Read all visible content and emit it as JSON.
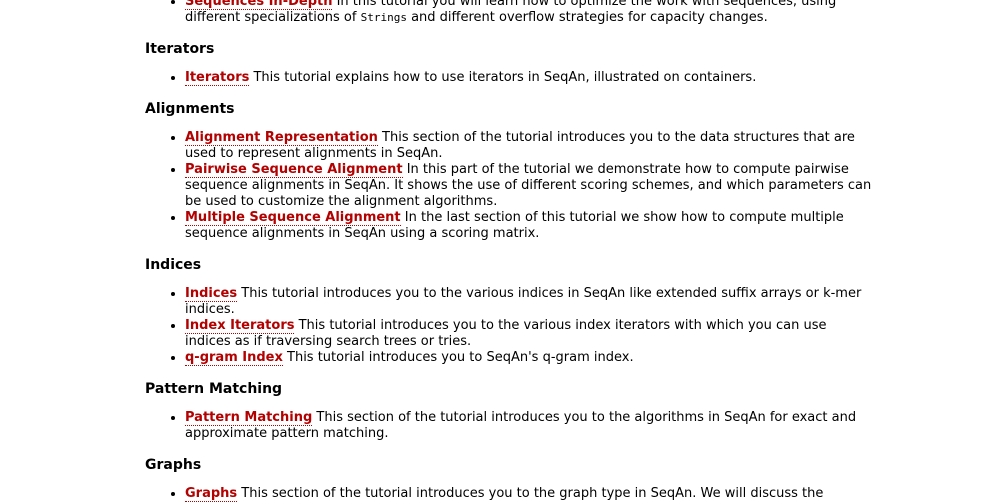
{
  "sections": [
    {
      "heading": "",
      "items": [
        {
          "link": "Sequences In-Depth",
          "text_before_code": " In this tutorial you will learn how to optimize the work with sequences, using different specializations of ",
          "code": "Strings",
          "text_after_code": " and different overflow strategies for capacity changes."
        }
      ]
    },
    {
      "heading": "Iterators",
      "items": [
        {
          "link": "Iterators",
          "text": " This tutorial explains how to use iterators in SeqAn, illustrated on containers."
        }
      ]
    },
    {
      "heading": "Alignments",
      "items": [
        {
          "link": "Alignment Representation",
          "text": " This section of the tutorial introduces you to the data structures that are used to represent alignments in SeqAn."
        },
        {
          "link": "Pairwise Sequence Alignment",
          "text": " In this part of the tutorial we demonstrate how to compute pairwise sequence alignments in SeqAn. It shows the use of different scoring schemes, and which parameters can be used to customize the alignment algorithms."
        },
        {
          "link": "Multiple Sequence Alignment",
          "text": " In the last section of this tutorial we show how to compute multiple sequence alignments in SeqAn using a scoring matrix."
        }
      ]
    },
    {
      "heading": "Indices",
      "items": [
        {
          "link": "Indices",
          "text": " This tutorial introduces you to the various indices in SeqAn like extended suffix arrays or k-mer indices."
        },
        {
          "link": "Index Iterators",
          "text": " This tutorial introduces you to the various index iterators with which you can use indices as if traversing search trees or tries."
        },
        {
          "link": "q-gram Index",
          "text": " This tutorial introduces you to SeqAn's q-gram index."
        }
      ]
    },
    {
      "heading": "Pattern Matching",
      "items": [
        {
          "link": "Pattern Matching",
          "text": " This section of the tutorial introduces you to the algorithms in SeqAn for exact and approximate pattern matching."
        }
      ]
    },
    {
      "heading": "Graphs",
      "items": [
        {
          "link": "Graphs",
          "text": " This section of the tutorial introduces you to the graph type in SeqAn. We will discuss the"
        }
      ]
    }
  ]
}
